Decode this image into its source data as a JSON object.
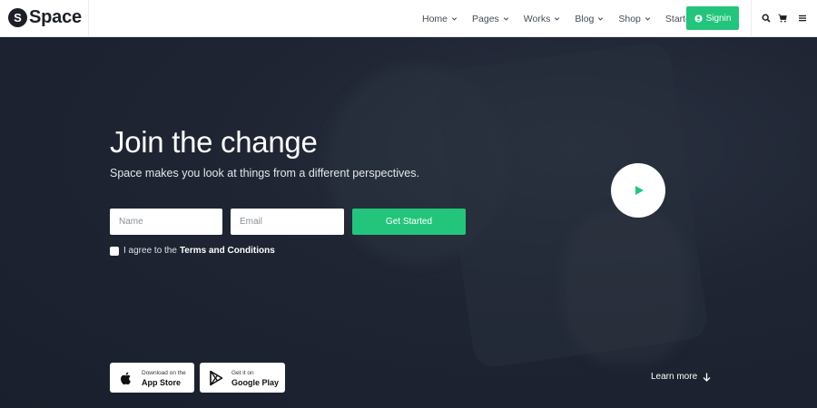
{
  "header": {
    "logo_letter": "S",
    "logo_text": "Space",
    "nav": [
      {
        "label": "Home"
      },
      {
        "label": "Pages"
      },
      {
        "label": "Works"
      },
      {
        "label": "Blog"
      },
      {
        "label": "Shop"
      },
      {
        "label": "Starter"
      }
    ],
    "signin_label": "Signin",
    "icons": [
      "user-circle-icon",
      "search-icon",
      "cart-icon",
      "menu-icon"
    ]
  },
  "hero": {
    "title": "Join the change",
    "subtitle": "Space makes you look at things from a different perspectives.",
    "form": {
      "name_placeholder": "Name",
      "email_placeholder": "Email",
      "cta_label": "Get Started",
      "agree_prefix": "I agree to the",
      "terms_label": "Terms and Conditions"
    },
    "stores": {
      "apple": {
        "small": "Download on the",
        "big": "App Store"
      },
      "google": {
        "small": "Get it on",
        "big": "Google Play"
      }
    },
    "learn_more": "Learn more",
    "icons": [
      "play-icon",
      "apple-icon",
      "google-play-icon",
      "arrow-down-icon"
    ]
  },
  "colors": {
    "accent": "#22c57b",
    "hero_bg": "#1b2231",
    "header_bg": "#ffffff"
  }
}
